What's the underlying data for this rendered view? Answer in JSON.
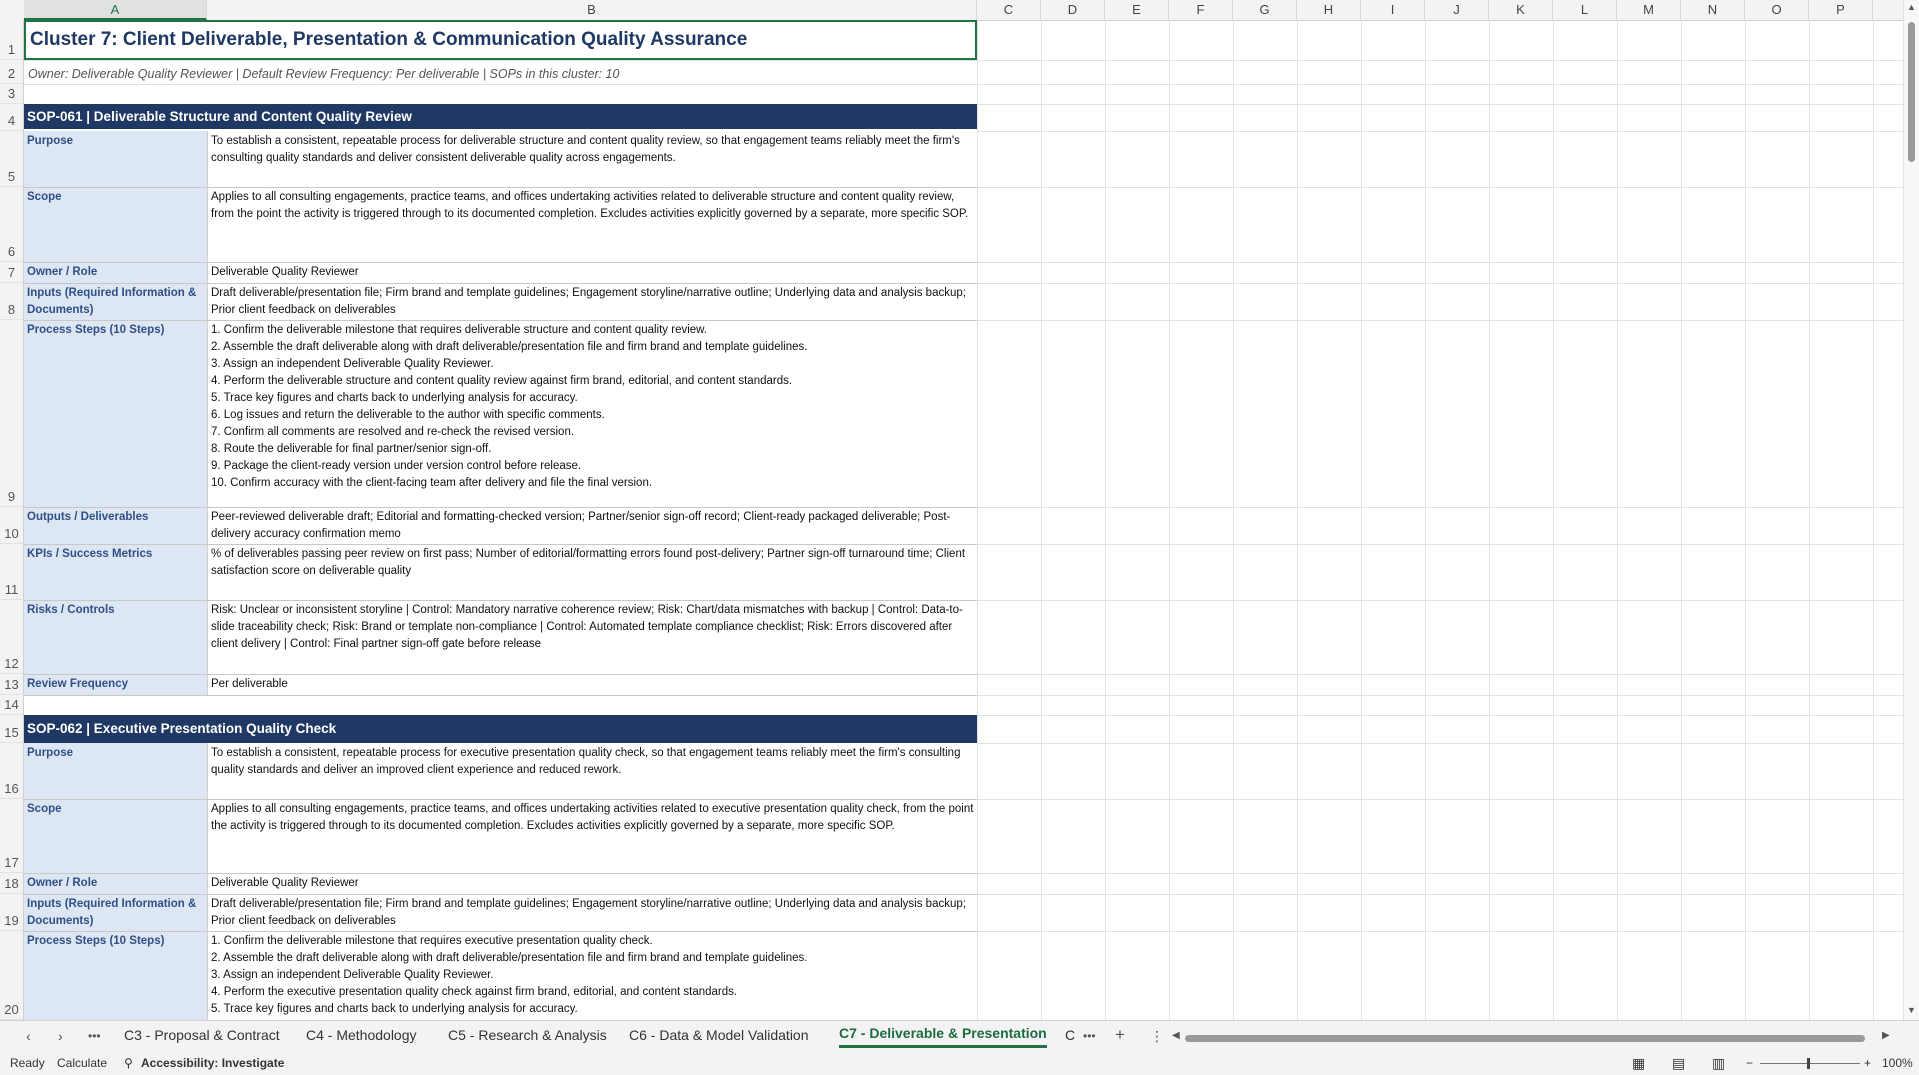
{
  "columns": [
    "A",
    "B",
    "C",
    "D",
    "E",
    "F",
    "G",
    "H",
    "I",
    "J",
    "K",
    "L",
    "M",
    "N",
    "O",
    "P"
  ],
  "selected_column": "A",
  "sheet": {
    "title": "Cluster 7: Client Deliverable, Presentation & Communication Quality Assurance",
    "subtitle": "Owner: Deliverable Quality Reviewer   |   Default Review Frequency: Per deliverable   |   SOPs in this cluster: 10",
    "sop1": {
      "header": "SOP-061  |  Deliverable Structure and Content Quality Review",
      "rows": [
        {
          "label": "Purpose",
          "text": "To establish a consistent, repeatable process for deliverable structure and content quality review, so that engagement teams reliably meet the firm's consulting quality standards and deliver consistent deliverable quality across engagements."
        },
        {
          "label": "Scope",
          "text": "Applies to all consulting engagements, practice teams, and offices undertaking activities related to deliverable structure and content quality review, from the point the activity is triggered through to its documented completion. Excludes activities explicitly governed by a separate, more specific SOP."
        },
        {
          "label": "Owner / Role",
          "text": "Deliverable Quality Reviewer"
        },
        {
          "label": "Inputs (Required Information & Documents)",
          "text": "Draft deliverable/presentation file; Firm brand and template guidelines; Engagement storyline/narrative outline; Underlying data and analysis backup; Prior client feedback on deliverables"
        },
        {
          "label": "Process Steps (10 Steps)",
          "text": "1. Confirm the deliverable milestone that requires deliverable structure and content quality review.\n2. Assemble the draft deliverable along with draft deliverable/presentation file and firm brand and template guidelines.\n3. Assign an independent Deliverable Quality Reviewer.\n4. Perform the deliverable structure and content quality review against firm brand, editorial, and content standards.\n5. Trace key figures and charts back to underlying analysis for accuracy.\n6. Log issues and return the deliverable to the author with specific comments.\n7. Confirm all comments are resolved and re-check the revised version.\n8. Route the deliverable for final partner/senior sign-off.\n9. Package the client-ready version under version control before release.\n10. Confirm accuracy with the client-facing team after delivery and file the final version."
        },
        {
          "label": "Outputs / Deliverables",
          "text": "Peer-reviewed deliverable draft; Editorial and formatting-checked version; Partner/senior sign-off record; Client-ready packaged deliverable; Post-delivery accuracy confirmation memo"
        },
        {
          "label": "KPIs / Success Metrics",
          "text": "% of deliverables passing peer review on first pass; Number of editorial/formatting errors found post-delivery; Partner sign-off turnaround time; Client satisfaction score on deliverable quality"
        },
        {
          "label": "Risks / Controls",
          "text": "Risk: Unclear or inconsistent storyline | Control: Mandatory narrative coherence review; Risk: Chart/data mismatches with backup | Control: Data-to-slide traceability check; Risk: Brand or template non-compliance | Control: Automated template compliance checklist; Risk: Errors discovered after client delivery | Control: Final partner sign-off gate before release"
        },
        {
          "label": "Review Frequency",
          "text": "Per deliverable"
        }
      ]
    },
    "sop2": {
      "header": "SOP-062  |  Executive Presentation Quality Check",
      "rows": [
        {
          "label": "Purpose",
          "text": "To establish a consistent, repeatable process for executive presentation quality check, so that engagement teams reliably meet the firm's consulting quality standards and deliver an improved client experience and reduced rework."
        },
        {
          "label": "Scope",
          "text": "Applies to all consulting engagements, practice teams, and offices undertaking activities related to executive presentation quality check, from the point the activity is triggered through to its documented completion. Excludes activities explicitly governed by a separate, more specific SOP."
        },
        {
          "label": "Owner / Role",
          "text": "Deliverable Quality Reviewer"
        },
        {
          "label": "Inputs (Required Information & Documents)",
          "text": "Draft deliverable/presentation file; Firm brand and template guidelines; Engagement storyline/narrative outline; Underlying data and analysis backup; Prior client feedback on deliverables"
        },
        {
          "label": "Process Steps (10 Steps)",
          "text": "1. Confirm the deliverable milestone that requires executive presentation quality check.\n2. Assemble the draft deliverable along with draft deliverable/presentation file and firm brand and template guidelines.\n3. Assign an independent Deliverable Quality Reviewer.\n4. Perform the executive presentation quality check against firm brand, editorial, and content standards.\n5. Trace key figures and charts back to underlying analysis for accuracy."
        }
      ]
    }
  },
  "row_numbers": [
    "1",
    "2",
    "3",
    "4",
    "5",
    "6",
    "7",
    "8",
    "9",
    "10",
    "11",
    "12",
    "13",
    "14",
    "15",
    "16",
    "17",
    "18",
    "19",
    "20"
  ],
  "tabs": {
    "items": [
      "C3 - Proposal & Contract",
      "C4 - Methodology",
      "C5 - Research & Analysis",
      "C6 - Data & Model Validation",
      "C7 - Deliverable & Presentation",
      "C"
    ],
    "active_index": 4,
    "more": "•••",
    "add": "+",
    "menu": "⋮"
  },
  "status": {
    "ready": "Ready",
    "calculate": "Calculate",
    "accessibility": "Accessibility: Investigate",
    "zoom": "100%",
    "minus": "−",
    "plus": "+"
  },
  "icons": {
    "prev": "chevron-left-icon",
    "next": "chevron-right-icon",
    "accessibility": "accessibility-icon",
    "normal_view": "normal-view-icon",
    "page_layout": "page-layout-icon",
    "page_break": "page-break-icon"
  }
}
